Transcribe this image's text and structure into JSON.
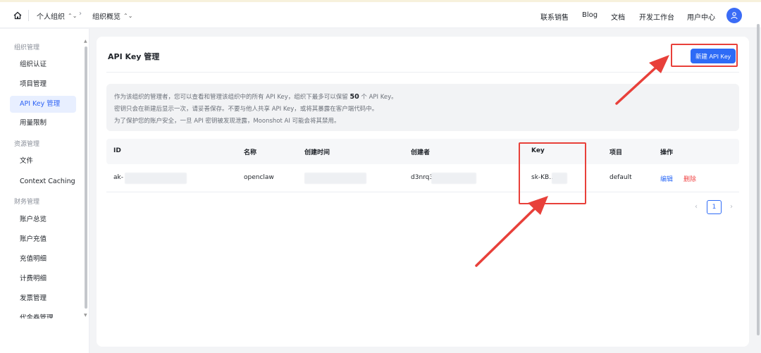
{
  "header": {
    "breadcrumbs": [
      {
        "label": "个人组织"
      },
      {
        "label": "组织概览"
      }
    ],
    "nav": [
      "联系销售",
      "Blog",
      "文档",
      "开发工作台",
      "用户中心"
    ]
  },
  "sidebar": {
    "groups": [
      {
        "title": "组织管理",
        "items": [
          "组织认证",
          "项目管理",
          "API Key 管理",
          "用量限制"
        ]
      },
      {
        "title": "资源管理",
        "items": [
          "文件",
          "Context Caching"
        ]
      },
      {
        "title": "财务管理",
        "items": [
          "账户总览",
          "账户充值",
          "充值明细",
          "计费明细",
          "发票管理",
          "代金券管理"
        ]
      }
    ],
    "active_item": "API Key 管理"
  },
  "main": {
    "title": "API Key 管理",
    "new_button": "新建 API Key",
    "notice": {
      "line1_a": "作为该组织的管理者，您可以查看和管理该组织中的所有 API Key，组织下最多可以保留",
      "line1_num": "50",
      "line1_b": "个 API Key。",
      "line2": "密钥只会在新建后显示一次，请妥善保存。不要与他人共享 API Key，或将其暴露在客户端代码中。",
      "line3": "为了保护您的账户安全，一旦 API 密钥被发现泄露，Moonshot AI 可能会将其禁用。"
    },
    "table": {
      "columns": [
        "ID",
        "名称",
        "创建时间",
        "创建者",
        "Key",
        "项目",
        "操作"
      ],
      "rows": [
        {
          "id": "ak-",
          "name": "openclaw",
          "created_at": "",
          "creator": "d3nrq3",
          "key": "sk-KB...",
          "project": "default",
          "actions": [
            "编辑",
            "删除"
          ]
        }
      ]
    },
    "pagination": {
      "current": "1"
    }
  },
  "colors": {
    "accent": "#2e6bf6",
    "danger": "#f04545",
    "annotation": "#e8403a"
  }
}
